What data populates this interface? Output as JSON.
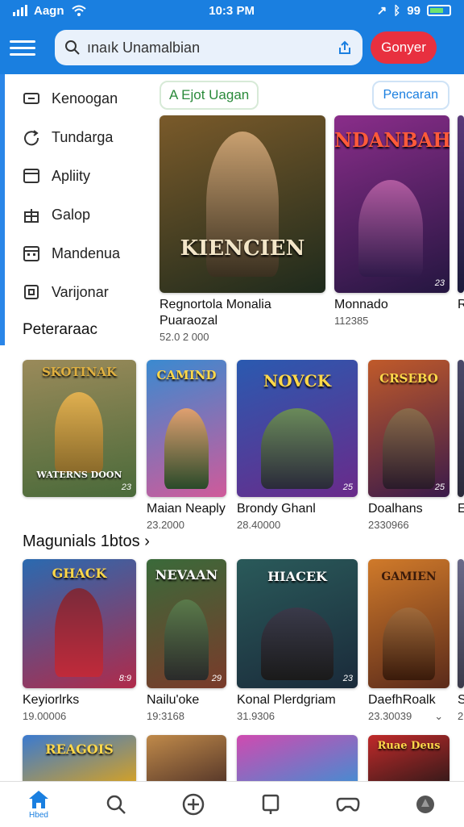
{
  "status": {
    "carrier": "Aagn",
    "time": "10:3 PM",
    "battery_text": "99"
  },
  "appbar": {
    "search_value": "ınaık Unamalbian",
    "generate_label": "Gonyer"
  },
  "sidebar": {
    "items": [
      {
        "label": "Kenoogan",
        "icon": "tag-icon"
      },
      {
        "label": "Tundarga",
        "icon": "refresh-icon"
      },
      {
        "label": "Apliity",
        "icon": "window-icon"
      },
      {
        "label": "Galop",
        "icon": "gift-icon"
      },
      {
        "label": "Mandenua",
        "icon": "calendar-icon"
      },
      {
        "label": "Varijonar",
        "icon": "box-icon"
      }
    ],
    "section_title": "Peteraraac"
  },
  "chips": {
    "filter": "A Ejot Uagan",
    "action": "Pencaran"
  },
  "featured": [
    {
      "thumb_title": "KIENCIEN",
      "title": "Regnortola Monalia",
      "title2": "Puaraozal",
      "meta": "52.0 2 000",
      "badge": "",
      "c1": "#7a5a2a",
      "c2": "#1e2a1c"
    },
    {
      "thumb_title": "NDANBAH",
      "title": "Monnado",
      "meta": "112385",
      "badge": "23",
      "c1": "#8a2d8a",
      "c2": "#241640"
    },
    {
      "thumb_title": "",
      "title": "R",
      "meta": "",
      "badge": "",
      "c1": "#5a3a7a",
      "c2": "#1a1a3a"
    }
  ],
  "row2": [
    {
      "thumb_title": "SKOTINAK",
      "sub": "WATERNS DOON",
      "title": "",
      "meta": "",
      "badge": "23",
      "c1": "#9a8a5a",
      "c2": "#4a6a3a"
    },
    {
      "thumb_title": "CAMIND",
      "title": "Maian Neaply",
      "meta": "23.2000",
      "badge": "",
      "c1": "#3a8ad0",
      "c2": "#d05a9a"
    },
    {
      "thumb_title": "NOVCK",
      "title": "Brondy Ghanl",
      "meta": "28.40000",
      "badge": "25",
      "c1": "#2a5ab0",
      "c2": "#6a2a8a"
    },
    {
      "thumb_title": "CRSEBO",
      "title": "Doalhans",
      "meta": "2330966",
      "badge": "25",
      "c1": "#c05a2a",
      "c2": "#3a1a4a"
    },
    {
      "thumb_title": "",
      "title": "E",
      "meta": "",
      "badge": "",
      "c1": "#4a4a6a",
      "c2": "#2a2a3a"
    }
  ],
  "section2_title": "Magunials 1btos",
  "row3": [
    {
      "thumb_title": "GHACK",
      "title": "Keyiorlrks",
      "meta": "19.00006",
      "badge": "8:9",
      "c1": "#2a6ab0",
      "c2": "#b02a4a"
    },
    {
      "thumb_title": "NEVAAN",
      "title": "Nailu'oke",
      "meta": "19:3168",
      "badge": "29",
      "c1": "#3a6a3a",
      "c2": "#7a3a2a"
    },
    {
      "thumb_title": "HIACEK",
      "title": "Konal Plerdgriam",
      "meta": "31.9306",
      "badge": "23",
      "c1": "#2a5a5a",
      "c2": "#1a2a3a"
    },
    {
      "thumb_title": "GAMIEN",
      "title": "DaefhRoalk",
      "meta": "23.30039",
      "badge": "",
      "c1": "#d07a2a",
      "c2": "#5a2a1a"
    },
    {
      "thumb_title": "",
      "title": "S",
      "meta": "2",
      "badge": "",
      "c1": "#6a6a8a",
      "c2": "#3a3a4a"
    }
  ],
  "row4": [
    {
      "thumb_title": "REAGOIS",
      "c1": "#3a7ad0",
      "c2": "#d0a02a"
    },
    {
      "thumb_title": "",
      "c1": "#c08a4a",
      "c2": "#5a3a2a"
    },
    {
      "thumb_title": "",
      "c1": "#d04ab0",
      "c2": "#4a8ad0"
    },
    {
      "thumb_title": "Ruae Deus",
      "c1": "#c02a2a",
      "c2": "#3a1a1a"
    }
  ],
  "bottom_nav": {
    "home_label": "Hbed"
  }
}
